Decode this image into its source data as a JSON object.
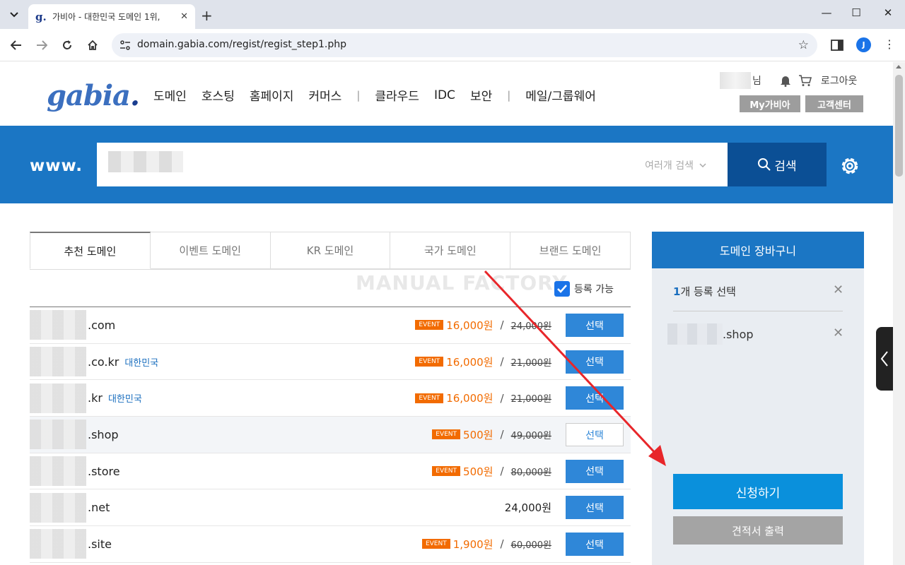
{
  "browser": {
    "tab_title": "가비아 - 대한민국 도메인 1위,",
    "tab_close": "✕",
    "new_tab": "+",
    "url": "domain.gabia.com/regist/regist_step1.php",
    "profile_initial": "J"
  },
  "header": {
    "logo_text": "gabia",
    "logo_dot": ".",
    "nav": [
      "도메인",
      "호스팅",
      "홈페이지",
      "커머스",
      "클라우드",
      "IDC",
      "보안",
      "메일/그룹웨어"
    ],
    "nav_sep": "|",
    "user_suffix": "님",
    "logout": "로그아웃",
    "my_gabia": "My가비아",
    "support": "고객센터"
  },
  "search": {
    "prefix": "www.",
    "multi_search": "여러개 검색",
    "button": "검색"
  },
  "tabs": [
    "추천 도메인",
    "이벤트 도메인",
    "KR 도메인",
    "국가 도메인",
    "브랜드 도메인"
  ],
  "watermark": "MANUAL FACTORY",
  "available_label": "등록 가능",
  "event_badge": "EVENT",
  "select_label": "선택",
  "domains": [
    {
      "tld": ".com",
      "country": "",
      "event": true,
      "price": "16,000원",
      "orig": "24,000원"
    },
    {
      "tld": ".co.kr",
      "country": "대한민국",
      "event": true,
      "price": "16,000원",
      "orig": "21,000원"
    },
    {
      "tld": ".kr",
      "country": "대한민국",
      "event": true,
      "price": "16,000원",
      "orig": "21,000원"
    },
    {
      "tld": ".shop",
      "country": "",
      "event": true,
      "price": "500원",
      "orig": "49,000원",
      "selected": true
    },
    {
      "tld": ".store",
      "country": "",
      "event": true,
      "price": "500원",
      "orig": "80,000원"
    },
    {
      "tld": ".net",
      "country": "",
      "event": false,
      "price": "24,000원",
      "orig": ""
    },
    {
      "tld": ".site",
      "country": "",
      "event": true,
      "price": "1,900원",
      "orig": "60,000원"
    }
  ],
  "cart": {
    "title": "도메인 장바구니",
    "count_num": "1",
    "count_text": "개 등록 선택",
    "item_tld": ".shop",
    "apply": "신청하기",
    "quote": "견적서 출력"
  },
  "colors": {
    "brand_blue": "#1b76c4",
    "search_button": "#0b4f95",
    "event_orange": "#f26b00",
    "apply_button": "#0a90dc",
    "annotation_arrow": "#e8262a"
  }
}
